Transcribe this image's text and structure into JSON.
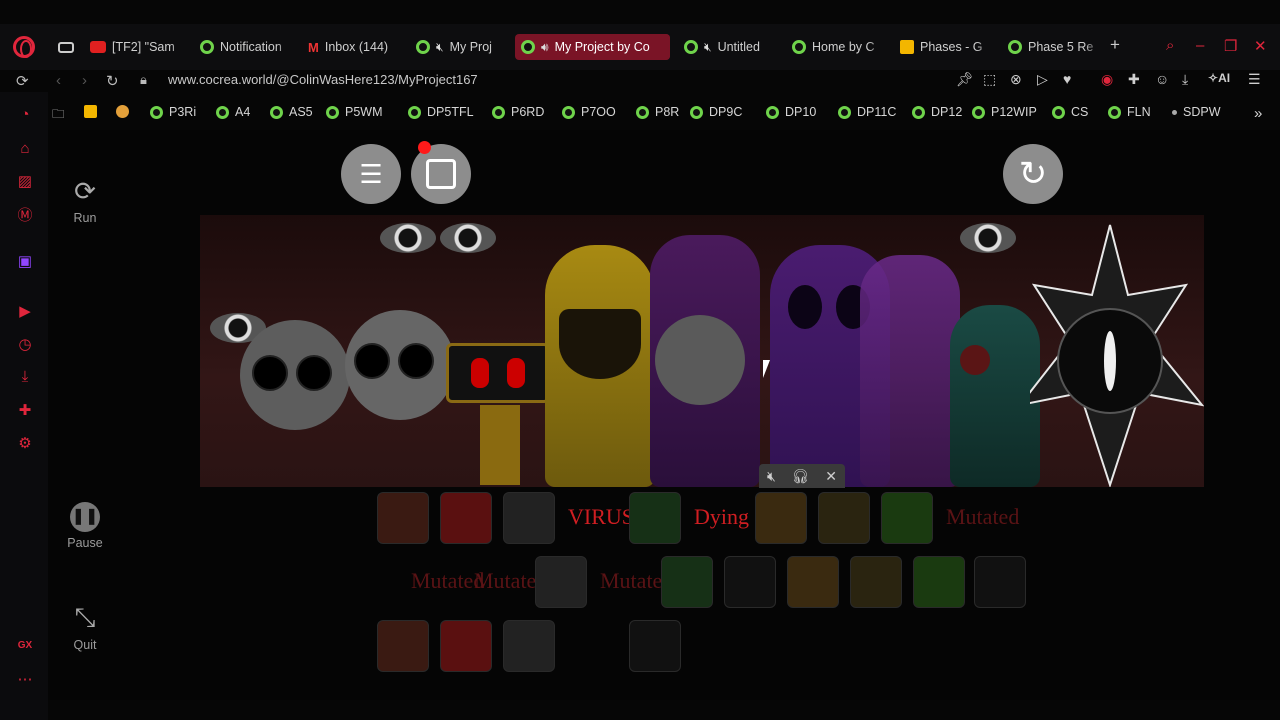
{
  "tabs": [
    {
      "label": "[TF2] \"Sam",
      "icon": "youtube-icon"
    },
    {
      "label": "Notification",
      "icon": "cocrea-icon"
    },
    {
      "label": "Inbox (144)",
      "icon": "gmail-icon"
    },
    {
      "label": "My Proj",
      "icon": "cocrea-icon",
      "muted": true
    },
    {
      "label": "My Project by Co",
      "icon": "cocrea-icon",
      "active": true
    },
    {
      "label": "Untitled",
      "icon": "cocrea-icon",
      "muted": true
    },
    {
      "label": "Home by C",
      "icon": "cocrea-icon"
    },
    {
      "label": "Phases - G",
      "icon": "slides-icon"
    },
    {
      "label": "Phase 5 Re",
      "icon": "cocrea-icon"
    }
  ],
  "address": {
    "url": "www.cocrea.world/@ColinWasHere123/MyProject167"
  },
  "toolbar": {
    "ai_label": "AI"
  },
  "bookmarks": [
    "P3Ri",
    "A4",
    "AS5",
    "P5WM",
    "DP5TFL",
    "P6RD",
    "P7OO",
    "P8R",
    "DP9C",
    "DP10",
    "DP11C",
    "DP12",
    "P12WIP",
    "CS",
    "FLN",
    "SDPW"
  ],
  "player": {
    "run_label": "Run",
    "pause_label": "Pause",
    "quit_label": "Quit"
  },
  "slots": {
    "row1": [
      "",
      "",
      "",
      "VIRUS",
      "",
      "Dying",
      "",
      "",
      "",
      "Mutated"
    ],
    "row2": [
      "Mutated",
      "Mutated",
      "",
      "Mutated",
      "",
      "",
      "",
      "",
      "",
      ""
    ],
    "row3": [
      "",
      "",
      "",
      ""
    ]
  },
  "colors": {
    "accent": "#e0263c",
    "active_tab": "#7a1426",
    "cocrea_green": "#6fd34b"
  }
}
